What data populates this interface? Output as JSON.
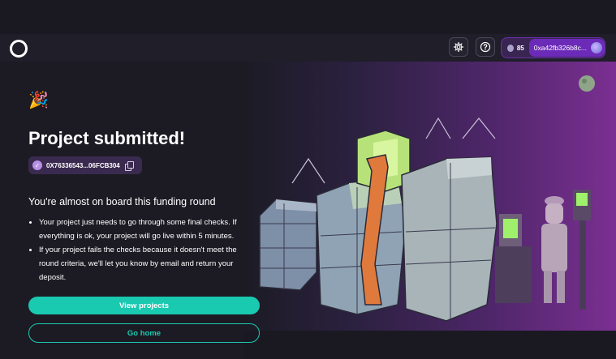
{
  "navbar": {
    "wallet_balance": "85",
    "wallet_address": "0xa42fb326b8c..."
  },
  "main": {
    "title": "Project submitted!",
    "project_hash": "0X76336543...06FCB304",
    "subtitle": "You're almost on board this funding round",
    "bullets": [
      "Your project just needs to go through some final checks. If everything is ok, your project will go live within 5 minutes.",
      "If your project fails the checks because it doesn't meet the round criteria, we'll let you know by email and return your deposit."
    ],
    "view_projects_label": "View projects",
    "go_home_label": "Go home"
  },
  "icons": {
    "logo": "logo-ring-icon",
    "settings": "gear-icon",
    "help": "question-circle-icon",
    "party": "party-popper-icon",
    "check": "check-circle-icon",
    "copy": "copy-icon"
  },
  "colors": {
    "background": "#1b1a24",
    "accent_teal": "#19c9b0",
    "wallet_purple": "#6c2ab8",
    "hero_purple": "#7b2f92"
  }
}
